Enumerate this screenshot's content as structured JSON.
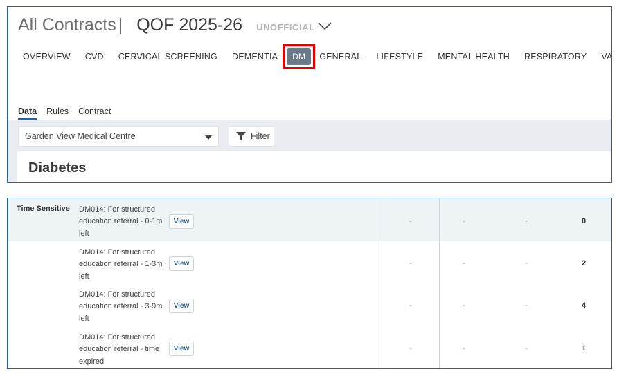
{
  "header": {
    "title": "All Contracts",
    "separator": "|",
    "contract": "QOF 2025-26",
    "badge": "UNOFFICIAL",
    "dropdown_icon": "chevron-down-icon"
  },
  "nav": {
    "items": [
      {
        "label": "OVERVIEW"
      },
      {
        "label": "CVD"
      },
      {
        "label": "CERVICAL SCREENING"
      },
      {
        "label": "DEMENTIA"
      },
      {
        "label": "DM",
        "active": true
      },
      {
        "label": "GENERAL"
      },
      {
        "label": "LIFESTYLE"
      },
      {
        "label": "MENTAL HEALTH"
      },
      {
        "label": "RESPIRATORY"
      },
      {
        "label": "VACCINATIONS"
      }
    ]
  },
  "subtabs": [
    {
      "label": "Data",
      "active": true
    },
    {
      "label": "Rules"
    },
    {
      "label": "Contract"
    }
  ],
  "toolbar": {
    "practice_select": "Garden View Medical Centre",
    "filter_label": "Filter",
    "filter_icon": "funnel-icon"
  },
  "section": {
    "title": "Diabetes"
  },
  "table": {
    "group_label": "Time Sensitive",
    "view_label": "View",
    "rows": [
      {
        "line1": "DM014: For structured",
        "line2": "education referral - 0-1m",
        "line3": "left",
        "c1": "-",
        "c2": "-",
        "c3": "-",
        "total": "0"
      },
      {
        "line1": "DM014: For structured",
        "line2": "education referral - 1-3m",
        "line3": "left",
        "c1": "-",
        "c2": "-",
        "c3": "-",
        "total": "2"
      },
      {
        "line1": "DM014: For structured",
        "line2": "education referral - 3-9m",
        "line3": "left",
        "c1": "-",
        "c2": "-",
        "c3": "-",
        "total": "4"
      },
      {
        "line1": "DM014: For structured",
        "line2": "education referral - time",
        "line3": "expired",
        "c1": "-",
        "c2": "-",
        "c3": "-",
        "total": "1"
      }
    ]
  },
  "colors": {
    "accent": "#2e6089",
    "active_pill": "#6b7a89",
    "highlight_border": "#e00000",
    "toolbar_bg": "#e9edf1"
  }
}
